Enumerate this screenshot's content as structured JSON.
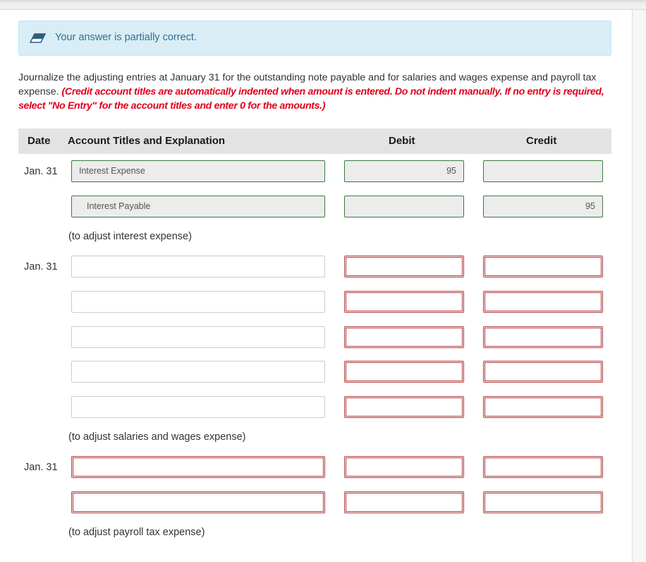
{
  "feedback": {
    "icon": "eraser-icon",
    "message": "Your answer is partially correct.",
    "color": "#31708f",
    "background": "#d9edf7"
  },
  "instructions": {
    "text": "Journalize the adjusting entries at January 31 for the outstanding note payable and for salaries and wages expense and payroll tax expense.",
    "note": "(Credit account titles are automatically indented when amount is entered. Do not indent manually. If no entry is required, select \"No Entry\" for the account titles and enter 0 for the amounts.)",
    "note_color": "#e0001b"
  },
  "table": {
    "headers": {
      "date": "Date",
      "account": "Account Titles and Explanation",
      "debit": "Debit",
      "credit": "Credit"
    },
    "entries": [
      {
        "date": "Jan. 31",
        "explanation": "(to adjust interest expense)",
        "rows": [
          {
            "account": "Interest Expense",
            "debit": "95",
            "credit": "",
            "state": "correct",
            "indent": false
          },
          {
            "account": "Interest Payable",
            "debit": "",
            "credit": "95",
            "state": "correct",
            "indent": true
          }
        ]
      },
      {
        "date": "Jan. 31",
        "explanation": "(to adjust salaries and wages expense)",
        "rows": [
          {
            "account": "",
            "debit": "",
            "credit": "",
            "account_state": "blank",
            "amount_state": "error"
          },
          {
            "account": "",
            "debit": "",
            "credit": "",
            "account_state": "blank",
            "amount_state": "error"
          },
          {
            "account": "",
            "debit": "",
            "credit": "",
            "account_state": "blank",
            "amount_state": "error"
          },
          {
            "account": "",
            "debit": "",
            "credit": "",
            "account_state": "blank",
            "amount_state": "error"
          },
          {
            "account": "",
            "debit": "",
            "credit": "",
            "account_state": "blank",
            "amount_state": "error"
          }
        ]
      },
      {
        "date": "Jan. 31",
        "explanation": "(to adjust payroll tax expense)",
        "rows": [
          {
            "account": "",
            "debit": "",
            "credit": "",
            "account_state": "error",
            "amount_state": "error"
          },
          {
            "account": "",
            "debit": "",
            "credit": "",
            "account_state": "error",
            "amount_state": "error"
          }
        ]
      }
    ]
  },
  "colors": {
    "correct_border": "#3a7a3a",
    "error_border": "#b03a3a",
    "header_bg": "#e3e3e3"
  }
}
